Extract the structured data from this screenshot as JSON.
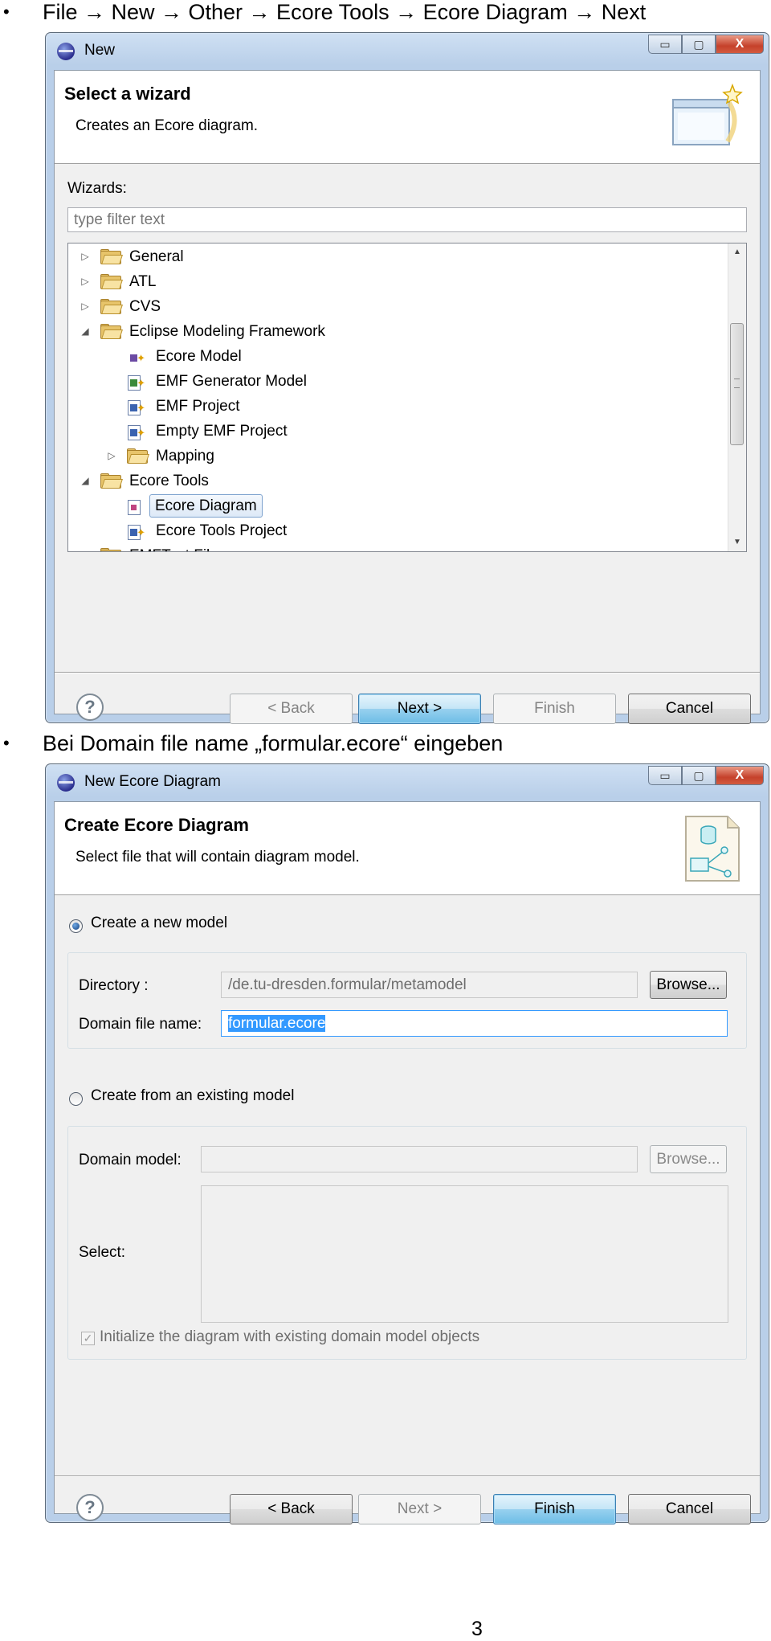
{
  "instructions": [
    {
      "bullet": "•",
      "text": "File → New → Other → Ecore Tools → Ecore Diagram → Next"
    },
    {
      "bullet": "•",
      "text": "Bei Domain file name „formular.ecore“ eingeben"
    }
  ],
  "window1": {
    "title": "New",
    "controls": {
      "minimize": "▭",
      "maximize": "▢",
      "close": "X"
    },
    "banner_title": "Select a wizard",
    "banner_subtitle": "Creates an Ecore diagram.",
    "wizards_label": "Wizards:",
    "filter_placeholder": "type filter text",
    "tree": [
      {
        "label": "General",
        "expander": "▷",
        "icon": "folder-icon"
      },
      {
        "label": "ATL",
        "expander": "▷",
        "icon": "folder-icon"
      },
      {
        "label": "CVS",
        "expander": "▷",
        "icon": "folder-icon"
      },
      {
        "label": "Eclipse Modeling Framework",
        "expander": "◢",
        "icon": "folder-icon"
      },
      {
        "label": "Ecore Model",
        "icon": "ecore-model-icon"
      },
      {
        "label": "EMF Generator Model",
        "icon": "emf-generator-model-icon"
      },
      {
        "label": "EMF Project",
        "icon": "emf-project-icon"
      },
      {
        "label": "Empty EMF Project",
        "icon": "empty-emf-project-icon"
      },
      {
        "label": "Mapping",
        "expander": "▷",
        "icon": "folder-icon"
      },
      {
        "label": "Ecore Tools",
        "expander": "◢",
        "icon": "folder-icon"
      },
      {
        "label": "Ecore Diagram",
        "icon": "ecore-diagram-icon",
        "selected": true
      },
      {
        "label": "Ecore Tools Project",
        "icon": "ecore-tools-project-icon"
      },
      {
        "label": "EMFText File",
        "expander": "▷",
        "icon": "folder-icon"
      }
    ],
    "scroll": {
      "up": "▲",
      "down": "▼"
    },
    "buttons": {
      "help": "?",
      "back": "< Back",
      "next": "Next >",
      "finish": "Finish",
      "cancel": "Cancel"
    }
  },
  "window2": {
    "title": "New Ecore Diagram",
    "controls": {
      "minimize": "▭",
      "maximize": "▢",
      "close": "X"
    },
    "banner_title": "Create Ecore Diagram",
    "banner_subtitle": "Select file that will contain diagram model.",
    "radio_new": "Create a new model",
    "directory_label": "Directory :",
    "directory_value": "/de.tu-dresden.formular/metamodel",
    "browse1": "Browse...",
    "domain_file_label": "Domain file name:",
    "domain_file_value": "formular.ecore",
    "radio_existing": "Create from an existing model",
    "domain_model_label": "Domain model:",
    "domain_model_value": "",
    "browse2": "Browse...",
    "select_label": "Select:",
    "init_checkbox": "Initialize the diagram with existing domain model objects",
    "check_mark": "✓",
    "buttons": {
      "help": "?",
      "back": "< Back",
      "next": "Next >",
      "finish": "Finish",
      "cancel": "Cancel"
    }
  },
  "page_number": "3"
}
